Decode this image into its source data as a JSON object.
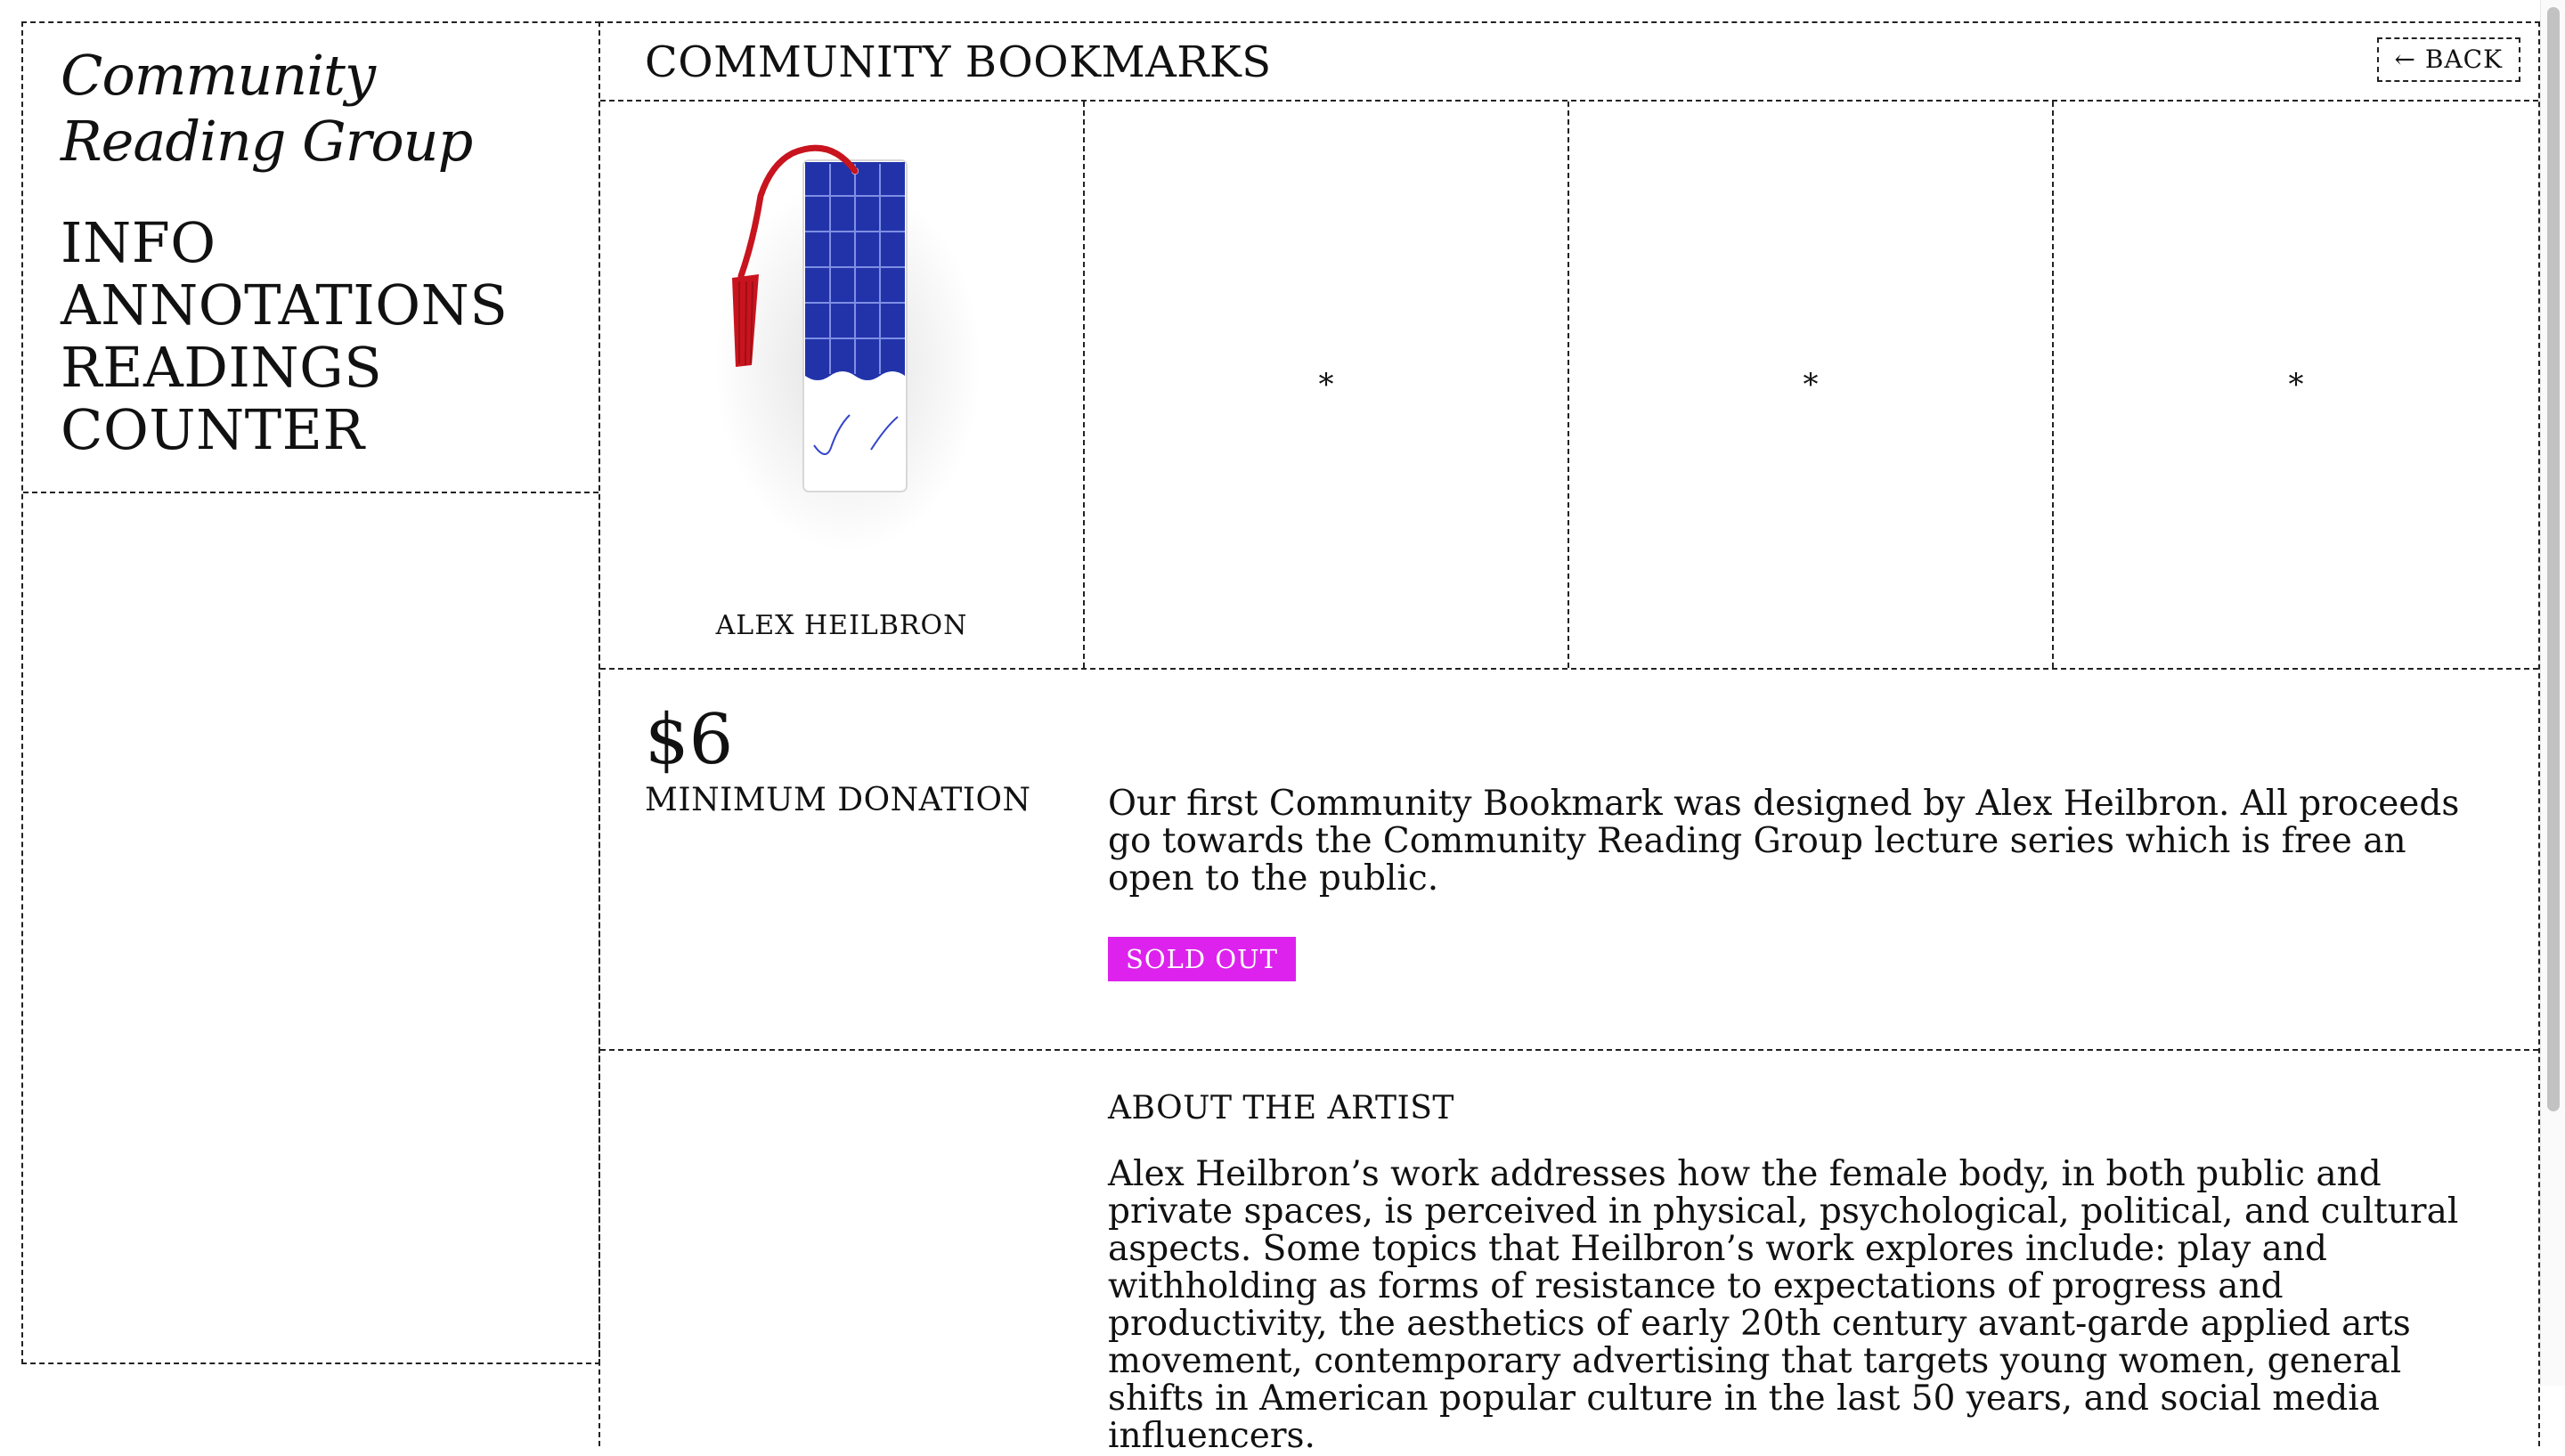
{
  "sidebar": {
    "brand_line1": "Community",
    "brand_line2": "Reading Group",
    "nav": [
      {
        "label": "INFO"
      },
      {
        "label": "ANNOTATIONS"
      },
      {
        "label": "READINGS"
      },
      {
        "label": "COUNTER"
      }
    ]
  },
  "header": {
    "title": "COMMUNITY BOOKMARKS",
    "back_label": "← BACK"
  },
  "gallery": {
    "caption": "ALEX HEILBRON",
    "placeholders": [
      "*",
      "*",
      "*"
    ]
  },
  "product": {
    "price": "$6",
    "price_label": "MINIMUM DONATION",
    "description": "Our first Community Bookmark was designed by Alex Heilbron. All proceeds go towards the Community Reading Group lecture series which is free an open to the public.",
    "status": "SOLD OUT",
    "status_color": "#dd22ee"
  },
  "about": {
    "heading": "ABOUT THE ARTIST",
    "text": "Alex Heilbron’s work addresses how the female body, in both public and private spaces, is perceived in physical, psychological, political, and cultural aspects. Some topics that Heilbron’s work explores include: play and withholding as forms of resistance to expectations of progress and productivity, the aesthetics of early 20th century avant-garde applied arts movement, contemporary advertising that targets young women, general shifts in American popular culture in the last 50 years, and social media influencers."
  },
  "colors": {
    "bookmark_blue": "#2233aa",
    "tassel_red": "#c8141e"
  }
}
